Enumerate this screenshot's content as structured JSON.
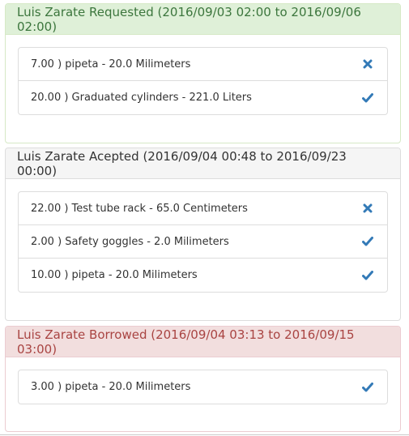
{
  "colors": {
    "icon_blue": "#337ab7",
    "success_text": "#3c763d",
    "success_bg": "#dff0d8",
    "danger_text": "#a94442",
    "danger_bg": "#f2dede",
    "default_bg": "#f5f5f5"
  },
  "panels": [
    {
      "title": "Luis Zarate Requested (2016/09/03 02:00 to 2016/09/06 02:00)",
      "items": [
        {
          "text": "7.00 ) pipeta - 20.0 Milimeters",
          "icon": "times-icon"
        },
        {
          "text": "20.00 ) Graduated cylinders - 221.0 Liters",
          "icon": "check-icon"
        }
      ]
    },
    {
      "title": "Luis Zarate Acepted (2016/09/04 00:48 to 2016/09/23 00:00)",
      "items": [
        {
          "text": "22.00 ) Test tube rack - 65.0 Centimeters",
          "icon": "times-icon"
        },
        {
          "text": "2.00 ) Safety goggles - 2.0 Milimeters",
          "icon": "check-icon"
        },
        {
          "text": "10.00 ) pipeta - 20.0 Milimeters",
          "icon": "check-icon"
        }
      ]
    },
    {
      "title": "Luis Zarate Borrowed (2016/09/04 03:13 to 2016/09/15 03:00)",
      "items": [
        {
          "text": "3.00 ) pipeta - 20.0 Milimeters",
          "icon": "check-icon"
        }
      ]
    }
  ]
}
